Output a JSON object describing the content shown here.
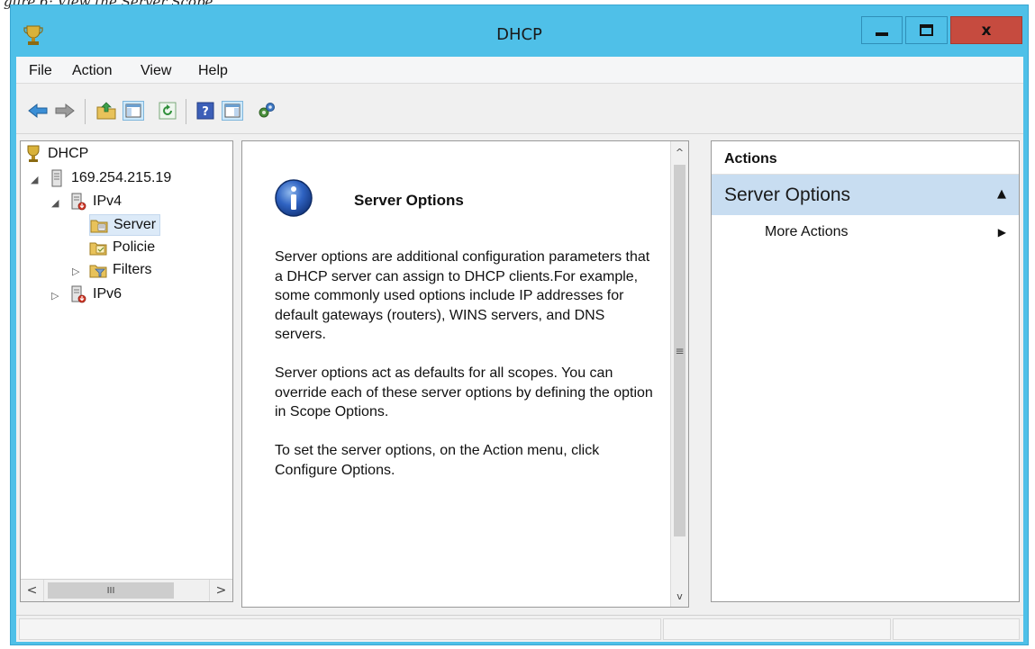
{
  "caption": {
    "text": "gure 6: View the Server Scope."
  },
  "window": {
    "title": "DHCP",
    "app_icon": "dhcp-trophy-icon",
    "controls": {
      "minimize_icon": "minimize-icon",
      "maximize_icon": "maximize-icon",
      "close_glyph": "x"
    },
    "title_bar_color": "#4fc0e8",
    "close_button_color": "#c64b3f"
  },
  "menubar": {
    "items": [
      {
        "label": "File"
      },
      {
        "label": "Action"
      },
      {
        "label": "View"
      },
      {
        "label": "Help"
      }
    ]
  },
  "toolbar": {
    "buttons": [
      {
        "icon": "back-arrow-icon"
      },
      {
        "icon": "forward-arrow-icon"
      },
      {
        "icon": "up-folder-icon"
      },
      {
        "icon": "show-hide-console-tree-icon",
        "active": true
      },
      {
        "icon": "refresh-icon"
      },
      {
        "icon": "help-icon"
      },
      {
        "icon": "show-hide-action-pane-icon",
        "active": true
      },
      {
        "icon": "configure-options-icon"
      }
    ]
  },
  "tree": {
    "items": [
      {
        "label": "DHCP",
        "icon": "dhcp-trophy-icon",
        "level": 0
      },
      {
        "label": "169.254.215.19",
        "icon": "server-icon",
        "level": 1,
        "expanded": true
      },
      {
        "label": "IPv4",
        "icon": "ipv4-icon",
        "level": 2,
        "expanded": true
      },
      {
        "label": "Server",
        "icon": "server-options-icon",
        "level": 3,
        "selected": true
      },
      {
        "label": "Policie",
        "icon": "policies-icon",
        "level": 3
      },
      {
        "label": "Filters",
        "icon": "filters-icon",
        "level": 3,
        "expanded": false
      },
      {
        "label": "IPv6",
        "icon": "ipv6-icon",
        "level": 2,
        "expanded": false
      }
    ],
    "hscroll": {
      "left_glyph": "<",
      "right_glyph": ">",
      "thumb_glyph": "III"
    }
  },
  "content": {
    "icon": "info-icon",
    "title": "Server Options",
    "paragraphs": [
      "Server options are additional configuration parameters that a DHCP server can assign to DHCP clients.For example, some commonly used options include IP addresses for default gateways (routers), WINS servers, and DNS servers.",
      "Server options act as defaults for all scopes.  You can override each of these server options by defining the option in Scope Options.",
      "To set the server options, on the Action menu, click Configure Options."
    ],
    "vscroll": {
      "up_glyph": "^",
      "down_glyph": "v",
      "thumb_glyph": "≡"
    }
  },
  "actions": {
    "header": "Actions",
    "section": {
      "label": "Server Options",
      "caret": "▲",
      "color": "#c8ddf1"
    },
    "items": [
      {
        "label": "More Actions",
        "arrow": "▶"
      }
    ]
  },
  "statusbar": {
    "cells": [
      "",
      "",
      ""
    ]
  }
}
